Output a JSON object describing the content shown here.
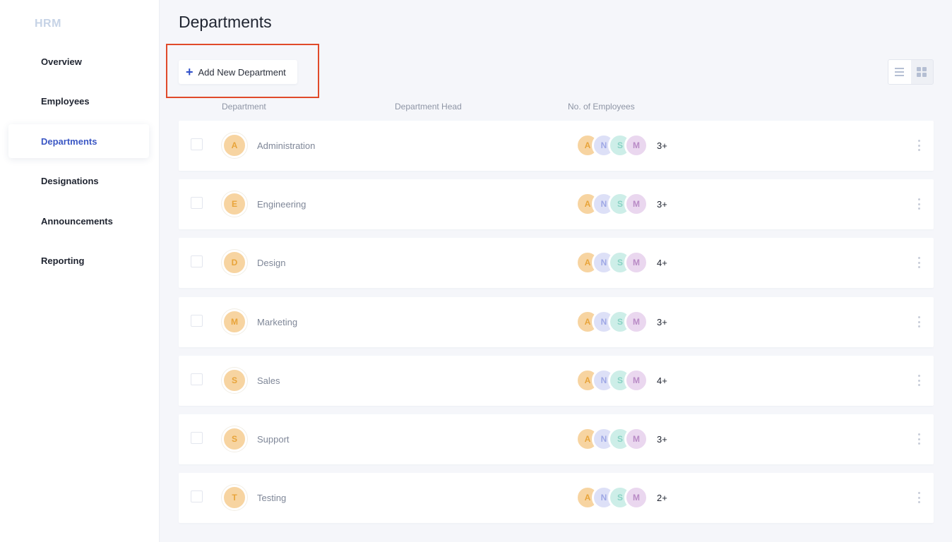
{
  "sidebar": {
    "brand": "HRM",
    "items": [
      {
        "label": "Overview",
        "active": false
      },
      {
        "label": "Employees",
        "active": false
      },
      {
        "label": "Departments",
        "active": true
      },
      {
        "label": "Designations",
        "active": false
      },
      {
        "label": "Announcements",
        "active": false
      },
      {
        "label": "Reporting",
        "active": false
      }
    ]
  },
  "header": {
    "title": "Departments",
    "add_button_label": "Add New Department"
  },
  "table": {
    "columns": [
      "Department",
      "Department Head",
      "No. of Employees"
    ],
    "rows": [
      {
        "initial": "A",
        "name": "Administration",
        "members": [
          "A",
          "N",
          "S",
          "M"
        ],
        "count": "3+"
      },
      {
        "initial": "E",
        "name": "Engineering",
        "members": [
          "A",
          "N",
          "S",
          "M"
        ],
        "count": "3+"
      },
      {
        "initial": "D",
        "name": "Design",
        "members": [
          "A",
          "N",
          "S",
          "M"
        ],
        "count": "4+"
      },
      {
        "initial": "M",
        "name": "Marketing",
        "members": [
          "A",
          "N",
          "S",
          "M"
        ],
        "count": "3+"
      },
      {
        "initial": "S",
        "name": "Sales",
        "members": [
          "A",
          "N",
          "S",
          "M"
        ],
        "count": "4+"
      },
      {
        "initial": "S",
        "name": "Support",
        "members": [
          "A",
          "N",
          "S",
          "M"
        ],
        "count": "3+"
      },
      {
        "initial": "T",
        "name": "Testing",
        "members": [
          "A",
          "N",
          "S",
          "M"
        ],
        "count": "2+"
      }
    ]
  },
  "colors": {
    "accent": "#3b57c4",
    "highlight": "#e04a2a"
  }
}
